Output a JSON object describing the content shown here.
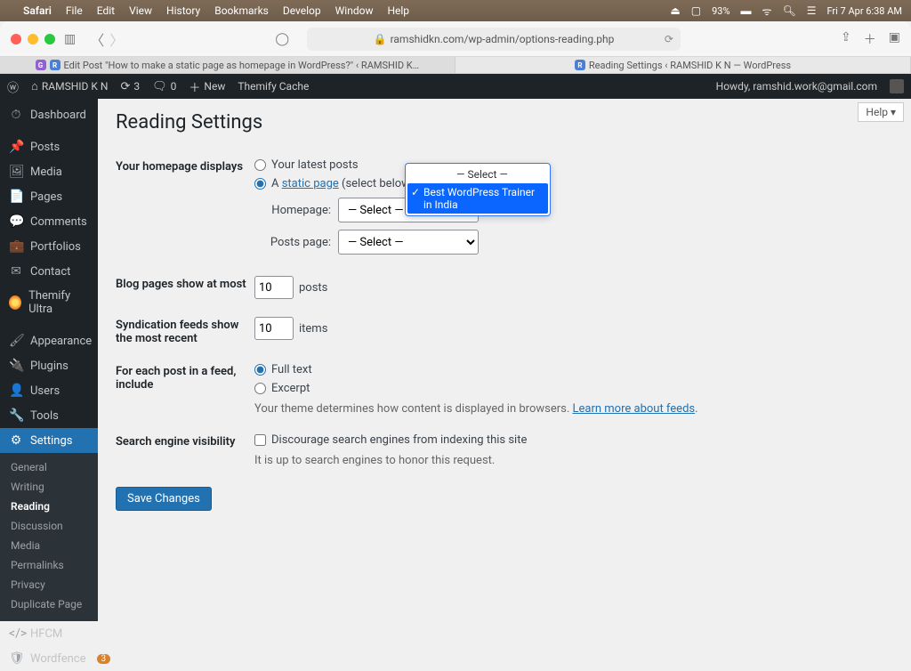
{
  "mac": {
    "app": "Safari",
    "menus": [
      "File",
      "Edit",
      "View",
      "History",
      "Bookmarks",
      "Develop",
      "Window",
      "Help"
    ],
    "battery": "93%",
    "clock": "Fri 7 Apr  6:38 AM"
  },
  "safari": {
    "url": "ramshidkn.com/wp-admin/options-reading.php",
    "tabs": [
      {
        "title": "Edit Post \"How to make a static page as homepage in WordPress?\" ‹ RAMSHID K N — WordPress",
        "active": false
      },
      {
        "title": "Reading Settings ‹ RAMSHID K N — WordPress",
        "active": true
      }
    ]
  },
  "wpbar": {
    "site": "RAMSHID K N",
    "updates": "3",
    "comments": "0",
    "new": "New",
    "cache": "Themify Cache",
    "howdy": "Howdy, ramshid.work@gmail.com"
  },
  "side": {
    "items": [
      {
        "icon": "⏱",
        "label": "Dashboard"
      },
      {
        "icon": "📌",
        "label": "Posts"
      },
      {
        "icon": "🖼",
        "label": "Media"
      },
      {
        "icon": "📄",
        "label": "Pages"
      },
      {
        "icon": "💬",
        "label": "Comments"
      },
      {
        "icon": "💼",
        "label": "Portfolios"
      },
      {
        "icon": "✉",
        "label": "Contact"
      },
      {
        "icon": "",
        "label": "Themify Ultra",
        "themify": true
      },
      {
        "icon": "🖌",
        "label": "Appearance"
      },
      {
        "icon": "🔌",
        "label": "Plugins"
      },
      {
        "icon": "👤",
        "label": "Users"
      },
      {
        "icon": "🔧",
        "label": "Tools"
      },
      {
        "icon": "⚙",
        "label": "Settings",
        "current": true
      },
      {
        "icon": "</>",
        "label": "HFCM"
      },
      {
        "icon": "🛡",
        "label": "Wordfence",
        "badge": "3"
      }
    ],
    "sub": [
      "General",
      "Writing",
      "Reading",
      "Discussion",
      "Media",
      "Permalinks",
      "Privacy",
      "Duplicate Page"
    ],
    "sub_current": "Reading"
  },
  "content": {
    "help": "Help ▾",
    "title": "Reading Settings",
    "homepage_label": "Your homepage displays",
    "opt_latest": "Your latest posts",
    "opt_static_a": "A ",
    "opt_static_link": "static page",
    "opt_static_b": " (select below)",
    "homepage_sel_label": "Homepage:",
    "posts_sel_label": "Posts page:",
    "select_ph": "— Select —",
    "dd_options": [
      "— Select —",
      "Best WordPress Trainer in India"
    ],
    "blog_label": "Blog pages show at most",
    "blog_val": "10",
    "blog_unit": "posts",
    "synd_label": "Syndication feeds show the most recent",
    "synd_val": "10",
    "synd_unit": "items",
    "feed_label": "For each post in a feed, include",
    "feed_full": "Full text",
    "feed_excerpt": "Excerpt",
    "feed_note_a": "Your theme determines how content is displayed in browsers. ",
    "feed_note_link": "Learn more about feeds",
    "sev_label": "Search engine visibility",
    "sev_check": "Discourage search engines from indexing this site",
    "sev_note": "It is up to search engines to honor this request.",
    "save": "Save Changes"
  }
}
